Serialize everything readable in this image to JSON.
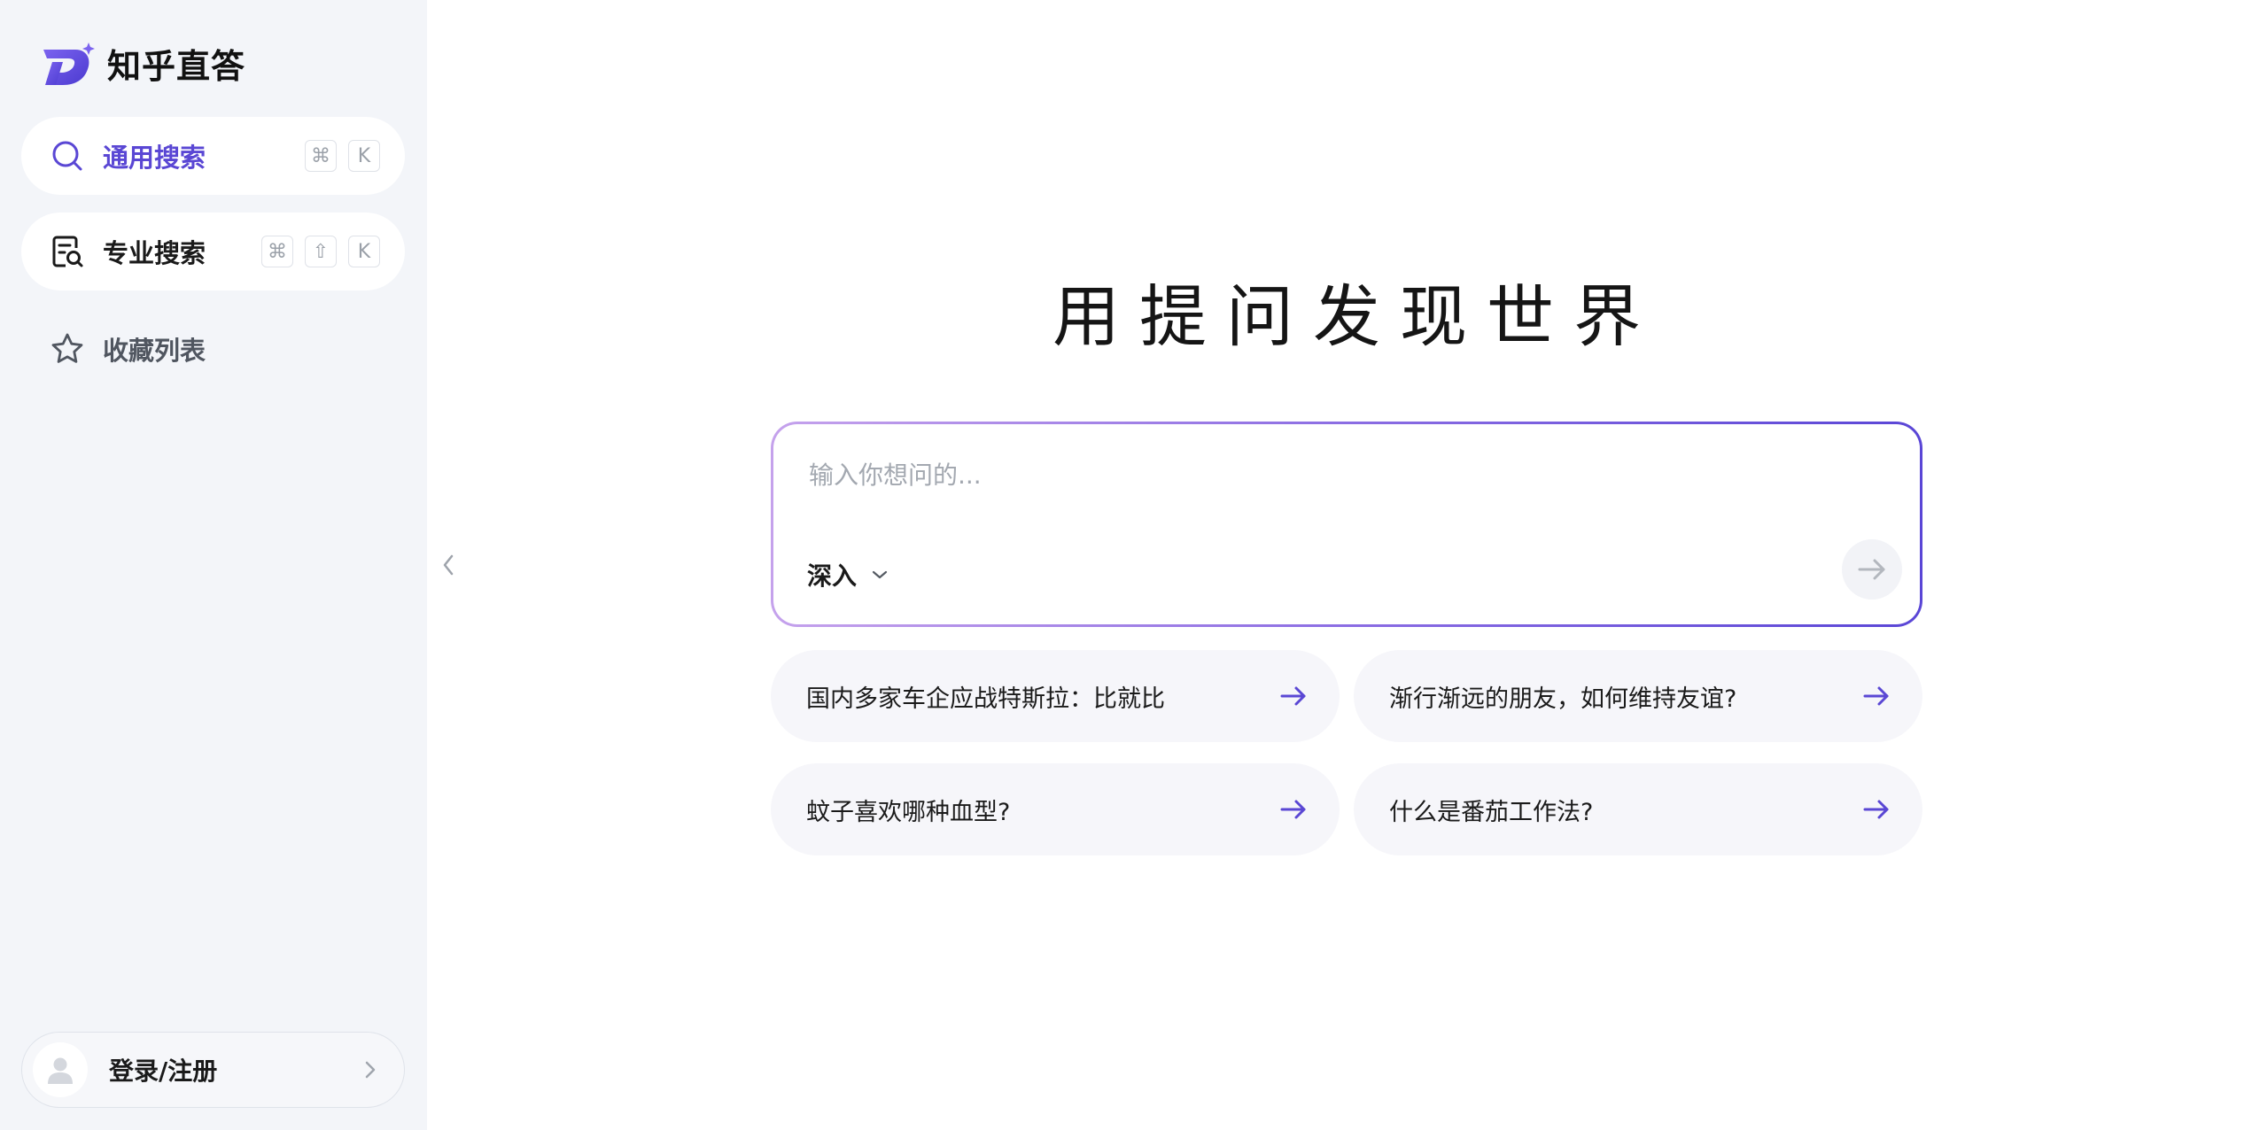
{
  "brand": {
    "name": "知乎直答",
    "accent": "#5a47d4"
  },
  "sidebar": {
    "items": [
      {
        "label": "通用搜索",
        "icon": "search-icon",
        "shortcut": [
          "⌘",
          "K"
        ]
      },
      {
        "label": "专业搜索",
        "icon": "doc-search-icon",
        "shortcut": [
          "⌘",
          "⇧",
          "K"
        ]
      },
      {
        "label": "收藏列表",
        "icon": "star-icon"
      }
    ],
    "login_label": "登录/注册"
  },
  "main": {
    "headline": "用提问发现世界",
    "search": {
      "placeholder": "输入你想问的...",
      "mode_label": "深入"
    },
    "suggestions": [
      "国内多家车企应战特斯拉：比就比",
      "渐行渐远的朋友，如何维持友谊?",
      "蚊子喜欢哪种血型?",
      "什么是番茄工作法?"
    ]
  }
}
